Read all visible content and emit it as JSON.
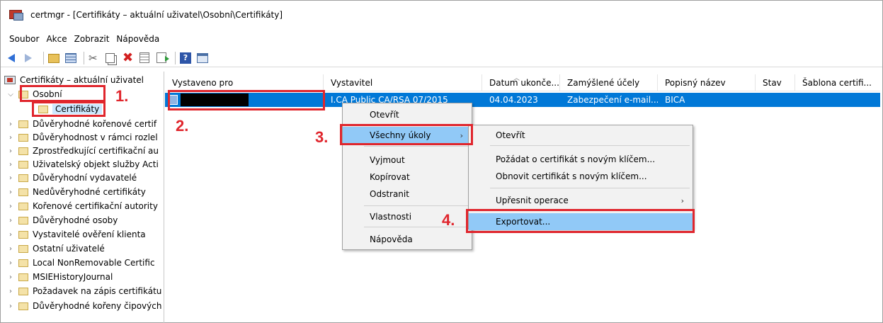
{
  "window": {
    "title": "certmgr - [Certifikáty – aktuální uživatel\\Osobní\\Certifikáty]"
  },
  "menu": [
    "Soubor",
    "Akce",
    "Zobrazit",
    "Nápověda"
  ],
  "toolbar": {
    "icons": [
      "back-icon",
      "forward-icon",
      "up-folder-icon",
      "show-hide-tree-icon",
      "cut-icon",
      "copy-icon",
      "delete-icon",
      "properties-icon",
      "export-list-icon",
      "help-icon",
      "console-window-icon"
    ]
  },
  "tree": {
    "root": "Certifikáty – aktuální uživatel",
    "osobni": "Osobní",
    "certifikaty": "Certifikáty",
    "items": [
      "Důvěryhodné kořenové certif",
      "Důvěryhodnost v rámci rozlel",
      "Zprostředkující certifikační au",
      "Uživatelský objekt služby Acti",
      "Důvěryhodní vydavatelé",
      "Nedůvěryhodné certifikáty",
      "Kořenové certifikační autority",
      "Důvěryhodné osoby",
      "Vystavitelé ověření klienta",
      "Ostatní uživatelé",
      "Local NonRemovable Certific",
      "MSIEHistoryJournal",
      "Požadavek na zápis certifikátu",
      "Důvěryhodné kořeny čipových"
    ]
  },
  "list": {
    "columns": [
      "Vystaveno pro",
      "Vystavitel",
      "Datum ukonče...",
      "Zamýšlené účely",
      "Popisný název",
      "Stav",
      "Šablona certifi..."
    ],
    "row": {
      "issued_to": "",
      "issuer": "I.CA Public CA/RSA 07/2015",
      "expiry": "04.04.2023",
      "purposes": "Zabezpečení e-mail...",
      "friendly_name": "BICA",
      "status": "",
      "template": ""
    }
  },
  "context_menu": {
    "items": [
      "Otevřít",
      "Všechny úkoly",
      "Vyjmout",
      "Kopírovat",
      "Odstranit",
      "Vlastnosti",
      "Nápověda"
    ]
  },
  "submenu": {
    "items": [
      "Otevřít",
      "Požádat o certifikát s novým klíčem...",
      "Obnovit certifikát s novým klíčem...",
      "Upřesnit operace",
      "Exportovat..."
    ]
  },
  "annotations": {
    "color": "#e0262d",
    "steps": [
      "1.",
      "2.",
      "3.",
      "4."
    ]
  },
  "colors": {
    "selection": "#0078d7",
    "menu_highlight": "#91c9f7",
    "tree_selection": "#cce8ff"
  }
}
